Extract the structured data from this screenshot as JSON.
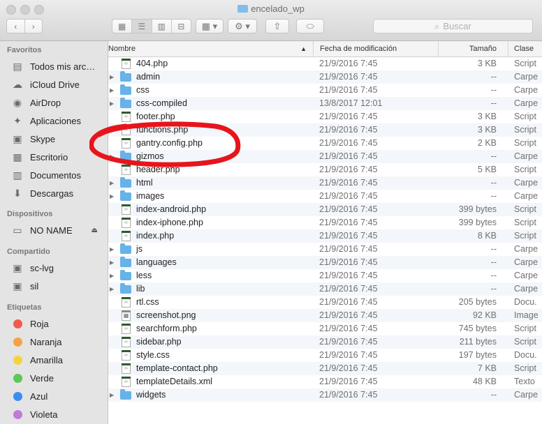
{
  "window": {
    "title": "encelado_wp"
  },
  "toolbar": {
    "search_placeholder": "Buscar"
  },
  "sidebar": {
    "sections": [
      {
        "heading": "Favoritos",
        "items": [
          {
            "label": "Todos mis arc…",
            "icon": "all-files-icon"
          },
          {
            "label": "iCloud Drive",
            "icon": "cloud-icon"
          },
          {
            "label": "AirDrop",
            "icon": "airdrop-icon"
          },
          {
            "label": "Aplicaciones",
            "icon": "applications-icon"
          },
          {
            "label": "Skype",
            "icon": "skype-icon"
          },
          {
            "label": "Escritorio",
            "icon": "desktop-icon"
          },
          {
            "label": "Documentos",
            "icon": "documents-icon"
          },
          {
            "label": "Descargas",
            "icon": "downloads-icon"
          }
        ]
      },
      {
        "heading": "Dispositivos",
        "items": [
          {
            "label": "NO NAME",
            "icon": "drive-icon"
          }
        ]
      },
      {
        "heading": "Compartido",
        "items": [
          {
            "label": "sc-lvg",
            "icon": "computer-icon"
          },
          {
            "label": "sil",
            "icon": "computer-icon"
          }
        ]
      },
      {
        "heading": "Etiquetas",
        "items": [
          {
            "label": "Roja",
            "color": "#f25a4e"
          },
          {
            "label": "Naranja",
            "color": "#f7a145"
          },
          {
            "label": "Amarilla",
            "color": "#f5d33f"
          },
          {
            "label": "Verde",
            "color": "#5cc857"
          },
          {
            "label": "Azul",
            "color": "#3d8cf2"
          },
          {
            "label": "Violeta",
            "color": "#c27ad8"
          }
        ]
      }
    ]
  },
  "columns": {
    "name": "Nombre",
    "date": "Fecha de modificación",
    "size": "Tamaño",
    "kind": "Clase"
  },
  "files": [
    {
      "name": "404.php",
      "date": "21/9/2016 7:45",
      "size": "3 KB",
      "kind": "Script",
      "type": "file"
    },
    {
      "name": "admin",
      "date": "21/9/2016 7:45",
      "size": "--",
      "kind": "Carpe",
      "type": "folder"
    },
    {
      "name": "css",
      "date": "21/9/2016 7:45",
      "size": "--",
      "kind": "Carpe",
      "type": "folder"
    },
    {
      "name": "css-compiled",
      "date": "13/8/2017 12:01",
      "size": "--",
      "kind": "Carpe",
      "type": "folder"
    },
    {
      "name": "footer.php",
      "date": "21/9/2016 7:45",
      "size": "3 KB",
      "kind": "Script",
      "type": "file"
    },
    {
      "name": "functions.php",
      "date": "21/9/2016 7:45",
      "size": "3 KB",
      "kind": "Script",
      "type": "file"
    },
    {
      "name": "gantry.config.php",
      "date": "21/9/2016 7:45",
      "size": "2 KB",
      "kind": "Script",
      "type": "file"
    },
    {
      "name": "gizmos",
      "date": "21/9/2016 7:45",
      "size": "--",
      "kind": "Carpe",
      "type": "folder"
    },
    {
      "name": "header.php",
      "date": "21/9/2016 7:45",
      "size": "5 KB",
      "kind": "Script",
      "type": "file"
    },
    {
      "name": "html",
      "date": "21/9/2016 7:45",
      "size": "--",
      "kind": "Carpe",
      "type": "folder"
    },
    {
      "name": "images",
      "date": "21/9/2016 7:45",
      "size": "--",
      "kind": "Carpe",
      "type": "folder"
    },
    {
      "name": "index-android.php",
      "date": "21/9/2016 7:45",
      "size": "399 bytes",
      "kind": "Script",
      "type": "file"
    },
    {
      "name": "index-iphone.php",
      "date": "21/9/2016 7:45",
      "size": "399 bytes",
      "kind": "Script",
      "type": "file"
    },
    {
      "name": "index.php",
      "date": "21/9/2016 7:45",
      "size": "8 KB",
      "kind": "Script",
      "type": "file"
    },
    {
      "name": "js",
      "date": "21/9/2016 7:45",
      "size": "--",
      "kind": "Carpe",
      "type": "folder"
    },
    {
      "name": "languages",
      "date": "21/9/2016 7:45",
      "size": "--",
      "kind": "Carpe",
      "type": "folder"
    },
    {
      "name": "less",
      "date": "21/9/2016 7:45",
      "size": "--",
      "kind": "Carpe",
      "type": "folder"
    },
    {
      "name": "lib",
      "date": "21/9/2016 7:45",
      "size": "--",
      "kind": "Carpe",
      "type": "folder"
    },
    {
      "name": "rtl.css",
      "date": "21/9/2016 7:45",
      "size": "205 bytes",
      "kind": "Docu.",
      "type": "file"
    },
    {
      "name": "screenshot.png",
      "date": "21/9/2016 7:45",
      "size": "92 KB",
      "kind": "Image",
      "type": "image"
    },
    {
      "name": "searchform.php",
      "date": "21/9/2016 7:45",
      "size": "745 bytes",
      "kind": "Script",
      "type": "file"
    },
    {
      "name": "sidebar.php",
      "date": "21/9/2016 7:45",
      "size": "211 bytes",
      "kind": "Script",
      "type": "file"
    },
    {
      "name": "style.css",
      "date": "21/9/2016 7:45",
      "size": "197 bytes",
      "kind": "Docu.",
      "type": "file"
    },
    {
      "name": "template-contact.php",
      "date": "21/9/2016 7:45",
      "size": "7 KB",
      "kind": "Script",
      "type": "file"
    },
    {
      "name": "templateDetails.xml",
      "date": "21/9/2016 7:45",
      "size": "48 KB",
      "kind": "Texto",
      "type": "file"
    },
    {
      "name": "widgets",
      "date": "21/9/2016 7:45",
      "size": "--",
      "kind": "Carpe",
      "type": "folder"
    }
  ],
  "annotation": {
    "color": "#e8141c"
  }
}
